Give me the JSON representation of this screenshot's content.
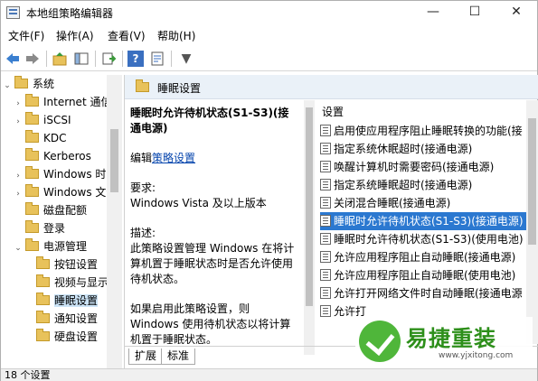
{
  "window": {
    "title": "本地组策略编辑器",
    "minimize_glyph": "—",
    "maximize_glyph": "☐",
    "close_glyph": "✕"
  },
  "menu": [
    "文件(F)",
    "操作(A)",
    "查看(V)",
    "帮助(H)"
  ],
  "toolbar": {
    "icons": [
      "back-arrow-icon",
      "forward-arrow-icon",
      "up-folder-icon",
      "show-tree-icon",
      "export-list-icon",
      "help-icon",
      "properties-icon",
      "filter-icon"
    ],
    "help_glyph": "?",
    "filter_glyph": "▼"
  },
  "tree": {
    "items": [
      {
        "label": "系统",
        "expander": "⌄"
      },
      {
        "label": "Internet 通信",
        "expander": "›"
      },
      {
        "label": "iSCSI",
        "expander": "›"
      },
      {
        "label": "KDC",
        "expander": ""
      },
      {
        "label": "Kerberos",
        "expander": ""
      },
      {
        "label": "Windows 时间",
        "expander": "›"
      },
      {
        "label": "Windows 文件",
        "expander": "›"
      },
      {
        "label": "磁盘配额",
        "expander": ""
      },
      {
        "label": "登录",
        "expander": ""
      },
      {
        "label": "电源管理",
        "expander": "⌄"
      },
      {
        "label": "按钮设置",
        "expander": ""
      },
      {
        "label": "视频与显示",
        "expander": ""
      },
      {
        "label": "睡眠设置",
        "expander": ""
      },
      {
        "label": "通知设置",
        "expander": ""
      },
      {
        "label": "硬盘设置",
        "expander": ""
      }
    ]
  },
  "details": {
    "header_title": "睡眠设置",
    "desc_title": "睡眠时允许待机状态(S1-S3)(接通电源)",
    "edit_prefix": "编辑",
    "edit_link": "策略设置",
    "requirements_label": "要求:",
    "requirements_value": "Windows Vista 及以上版本",
    "description_label": "描述:",
    "description_text": "此策略设置管理 Windows 在将计算机置于睡眠状态时是否允许使用待机状态。",
    "description_more": "如果启用此策略设置，则 Windows 使用待机状态以将计算机置于睡眠状态。"
  },
  "settings_list": {
    "header": "设置",
    "items": [
      "启用使应用程序阻止睡眠转换的功能(接",
      "指定系统休眠超时(接通电源)",
      "唤醒计算机时需要密码(接通电源)",
      "指定系统睡眠超时(接通电源)",
      "关闭混合睡眠(接通电源)",
      "睡眠时允许待机状态(S1-S3)(接通电源)",
      "睡眠时允许待机状态(S1-S3)(使用电池)",
      "允许应用程序阻止自动睡眠(接通电源)",
      "允许应用程序阻止自动睡眠(使用电池)",
      "允许打开网络文件时自动睡眠(接通电源",
      "允许打"
    ],
    "selected_index": 5
  },
  "tabs": [
    "扩展",
    "标准"
  ],
  "status": {
    "text": "18 个设置"
  },
  "watermark": {
    "name": "易捷重装",
    "url": "www.yjxitong.com"
  }
}
